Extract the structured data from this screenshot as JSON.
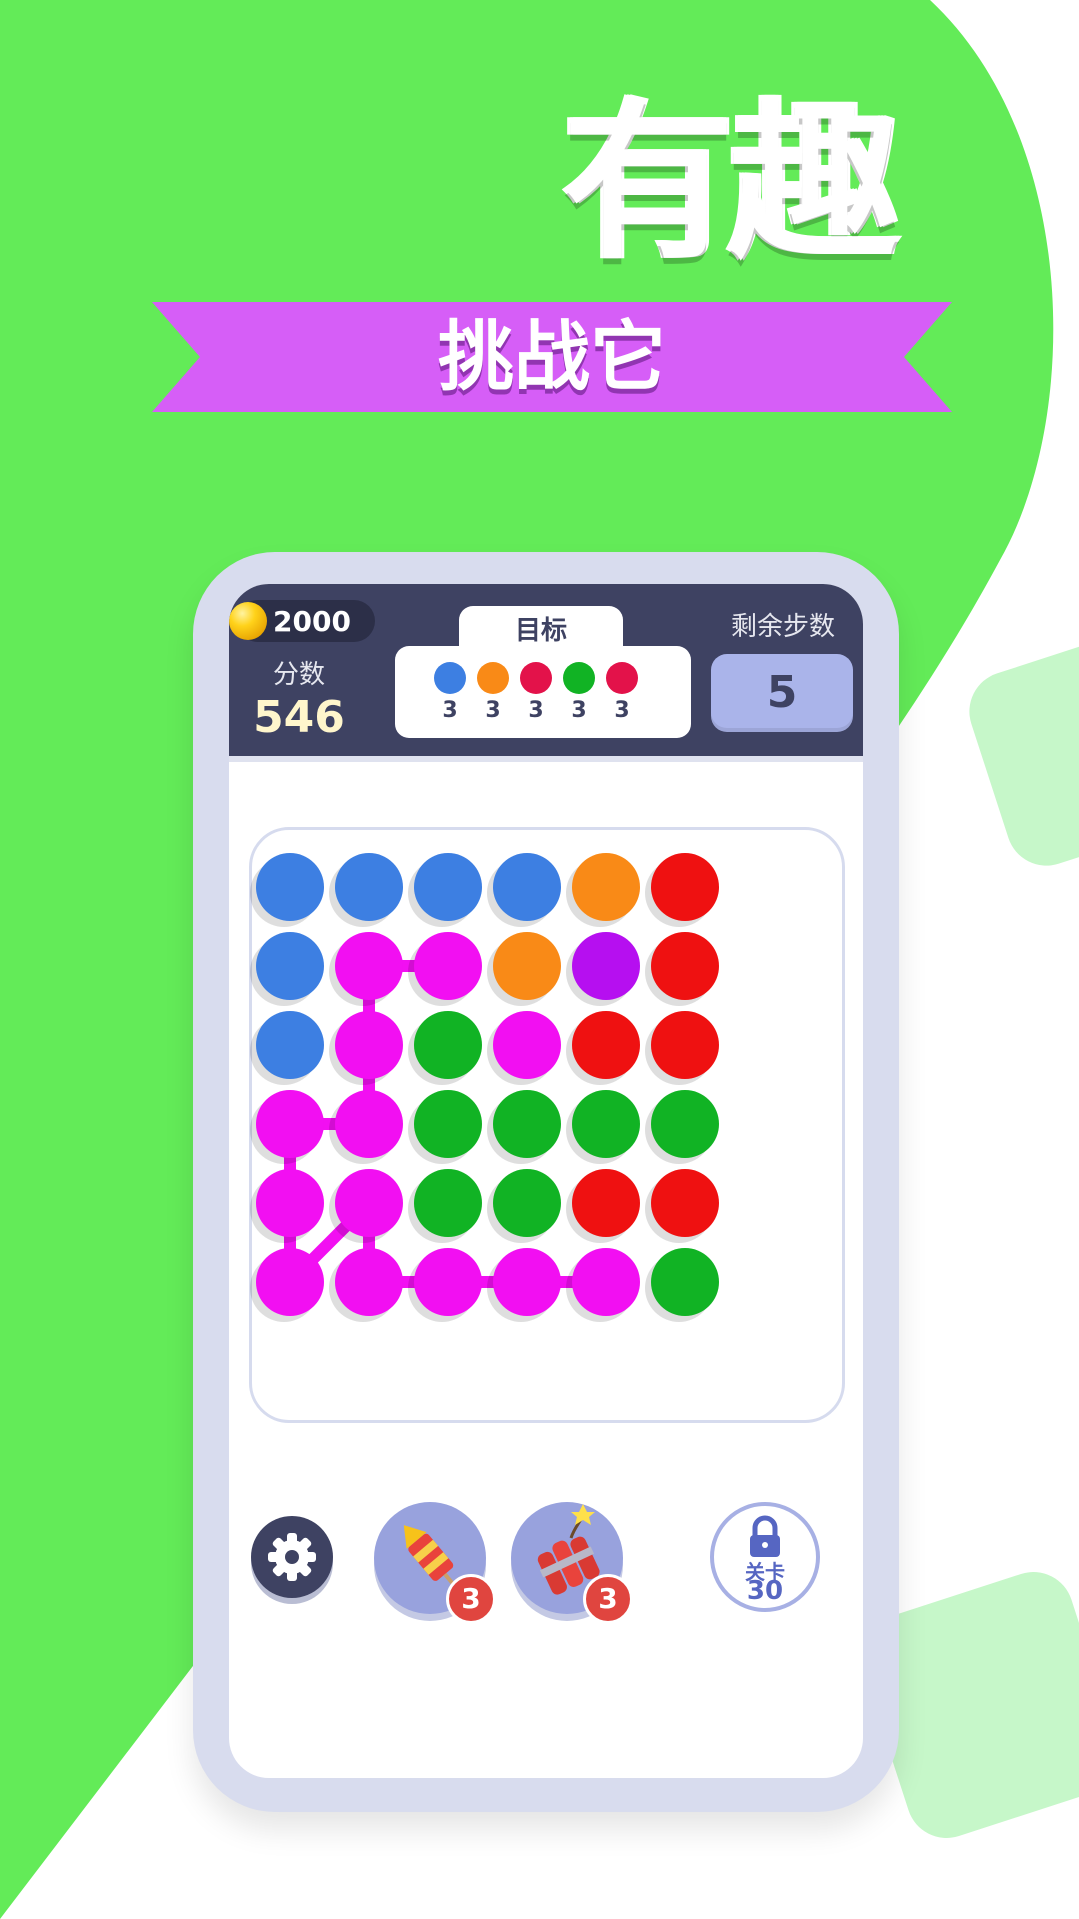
{
  "promo": {
    "headline": "有趣",
    "ribbon_text": "挑战它",
    "colors": {
      "green": "#63eb58",
      "ribbon": "#d65ef7",
      "deco": "#c6f7c9"
    }
  },
  "hud": {
    "coins": "2000",
    "score_label": "分数",
    "score_value": "546",
    "target_label": "目标",
    "targets": [
      {
        "color": "#3d7fe2",
        "count": "3"
      },
      {
        "color": "#f98a17",
        "count": "3"
      },
      {
        "color": "#e3124a",
        "count": "3"
      },
      {
        "color": "#11b324",
        "count": "3"
      },
      {
        "color": "#e3124a",
        "count": "3"
      }
    ],
    "steps_label": "剩余步数",
    "steps_value": "5"
  },
  "board": {
    "grid": [
      [
        "blue",
        "blue",
        "blue",
        "blue",
        "orange",
        "red"
      ],
      [
        "blue",
        "magenta",
        "magenta",
        "orange",
        "purple",
        "red"
      ],
      [
        "blue",
        "magenta",
        "green",
        "magenta",
        "red",
        "red"
      ],
      [
        "magenta",
        "magenta",
        "green",
        "green",
        "green",
        "green"
      ],
      [
        "magenta",
        "magenta",
        "green",
        "green",
        "red",
        "red"
      ],
      [
        "magenta",
        "magenta",
        "magenta",
        "magenta",
        "magenta",
        "green"
      ]
    ],
    "palette": {
      "blue": "#3d7fe2",
      "orange": "#f98a17",
      "red": "#ef1111",
      "green": "#11b324",
      "magenta": "#f20ff2",
      "purple": "#b60ff0"
    },
    "connections": [
      [
        [
          1,
          1
        ],
        [
          1,
          2
        ]
      ],
      [
        [
          1,
          1
        ],
        [
          2,
          1
        ]
      ],
      [
        [
          2,
          1
        ],
        [
          3,
          1
        ]
      ],
      [
        [
          3,
          1
        ],
        [
          3,
          0
        ]
      ],
      [
        [
          3,
          0
        ],
        [
          4,
          0
        ]
      ],
      [
        [
          4,
          0
        ],
        [
          5,
          0
        ]
      ],
      [
        [
          5,
          0
        ],
        [
          4,
          1
        ]
      ],
      [
        [
          4,
          1
        ],
        [
          5,
          1
        ]
      ],
      [
        [
          5,
          1
        ],
        [
          5,
          2
        ]
      ],
      [
        [
          5,
          2
        ],
        [
          5,
          3
        ]
      ],
      [
        [
          5,
          3
        ],
        [
          5,
          4
        ]
      ]
    ]
  },
  "toolbar": {
    "settings_icon": "gear-icon",
    "powerups": [
      {
        "icon": "firework-rocket-icon",
        "count": "3"
      },
      {
        "icon": "dynamite-icon",
        "count": "3"
      }
    ],
    "lock_label": "关卡",
    "lock_level": "30"
  }
}
